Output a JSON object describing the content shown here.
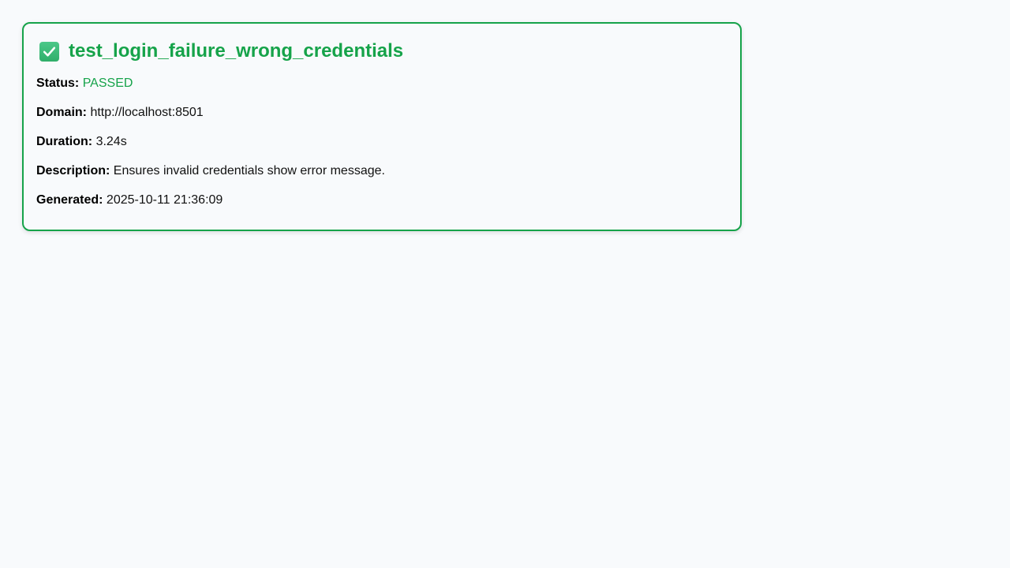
{
  "report": {
    "title": "test_login_failure_wrong_credentials",
    "status_icon": "check-mark-icon",
    "accent_color": "#16a34a",
    "fields": {
      "status": {
        "label": "Status:",
        "value": "PASSED"
      },
      "domain": {
        "label": "Domain:",
        "value": "http://localhost:8501"
      },
      "duration": {
        "label": "Duration:",
        "value": "3.24s"
      },
      "description": {
        "label": "Description:",
        "value": "Ensures invalid credentials show error message."
      },
      "generated": {
        "label": "Generated:",
        "value": "2025-10-11 21:36:09"
      }
    }
  }
}
